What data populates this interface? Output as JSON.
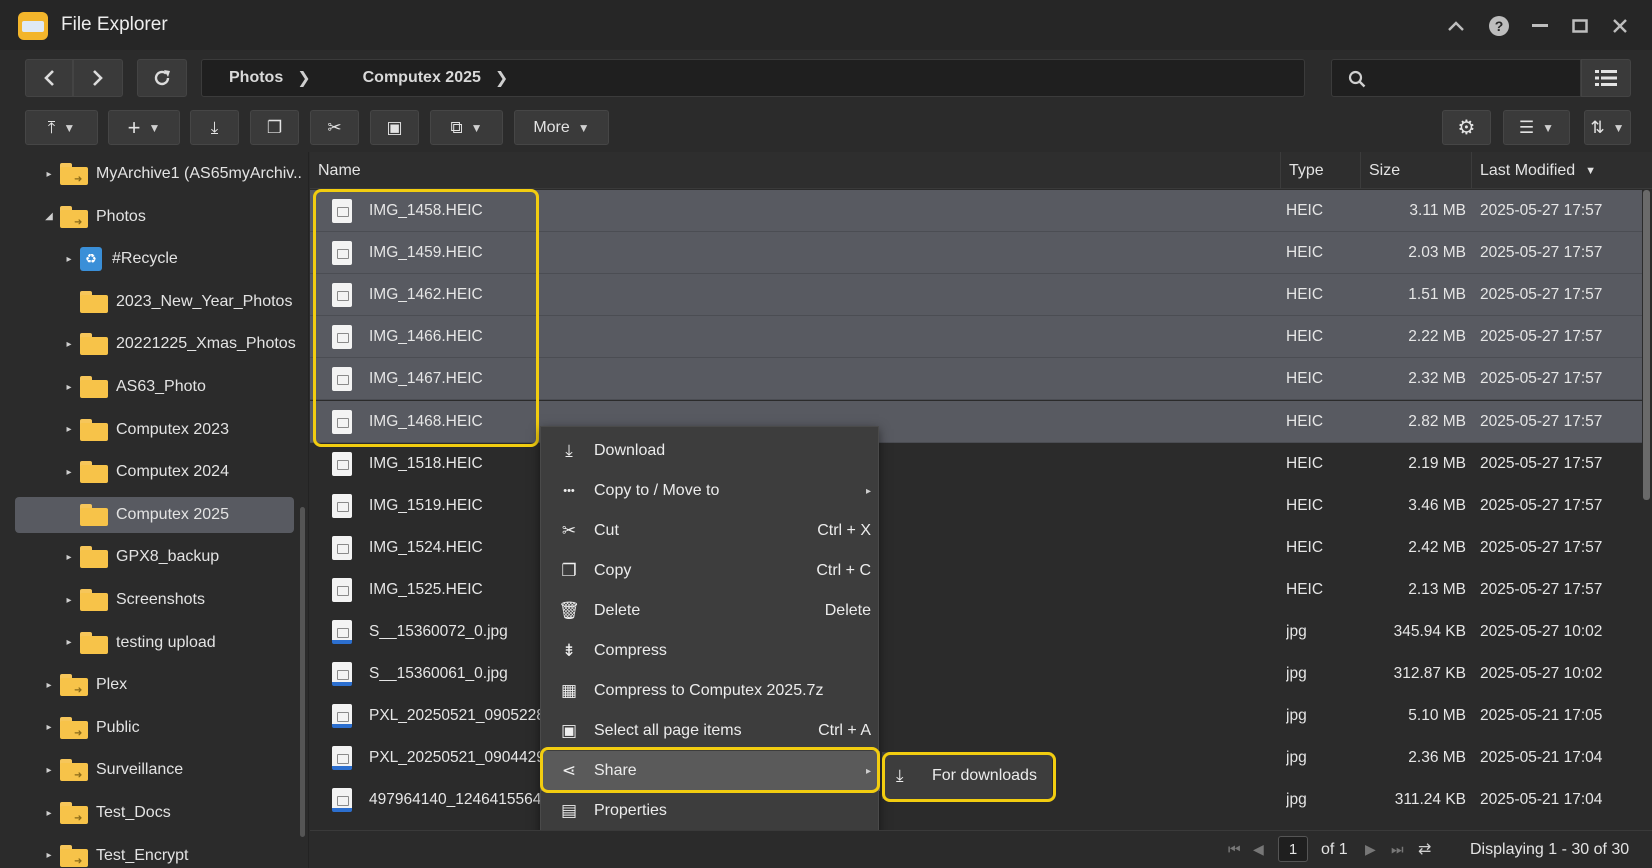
{
  "window": {
    "title": "File Explorer"
  },
  "breadcrumb": [
    {
      "label": "Photos"
    },
    {
      "label": "Computex 2025"
    }
  ],
  "search": {
    "placeholder": ""
  },
  "toolbar": {
    "more_label": "More"
  },
  "sidebar": {
    "items": [
      {
        "label": "MyArchive1 (AS65myArchiv..",
        "arrow": "▸",
        "kind": "share"
      },
      {
        "label": "Photos",
        "arrow": "◢",
        "kind": "share"
      },
      {
        "label": "#Recycle",
        "arrow": "▸",
        "kind": "recycle"
      },
      {
        "label": "2023_New_Year_Photos",
        "arrow": "",
        "kind": "folder"
      },
      {
        "label": "20221225_Xmas_Photos",
        "arrow": "▸",
        "kind": "folder"
      },
      {
        "label": "AS63_Photo",
        "arrow": "▸",
        "kind": "folder"
      },
      {
        "label": "Computex 2023",
        "arrow": "▸",
        "kind": "folder"
      },
      {
        "label": "Computex 2024",
        "arrow": "▸",
        "kind": "folder"
      },
      {
        "label": "Computex 2025",
        "arrow": "",
        "kind": "folder",
        "selected": true
      },
      {
        "label": "GPX8_backup",
        "arrow": "▸",
        "kind": "folder"
      },
      {
        "label": "Screenshots",
        "arrow": "▸",
        "kind": "folder"
      },
      {
        "label": "testing upload",
        "arrow": "▸",
        "kind": "folder"
      },
      {
        "label": "Plex",
        "arrow": "▸",
        "kind": "share"
      },
      {
        "label": "Public",
        "arrow": "▸",
        "kind": "share"
      },
      {
        "label": "Surveillance",
        "arrow": "▸",
        "kind": "share"
      },
      {
        "label": "Test_Docs",
        "arrow": "▸",
        "kind": "share"
      },
      {
        "label": "Test_Encrypt",
        "arrow": "▸",
        "kind": "share"
      }
    ]
  },
  "table": {
    "columns": {
      "name": "Name",
      "type": "Type",
      "size": "Size",
      "modified": "Last Modified"
    },
    "rows": [
      {
        "name": "IMG_1458.HEIC",
        "type": "HEIC",
        "size": "3.11 MB",
        "modified": "2025-05-27 17:57",
        "selected": true
      },
      {
        "name": "IMG_1459.HEIC",
        "type": "HEIC",
        "size": "2.03 MB",
        "modified": "2025-05-27 17:57",
        "selected": true
      },
      {
        "name": "IMG_1462.HEIC",
        "type": "HEIC",
        "size": "1.51 MB",
        "modified": "2025-05-27 17:57",
        "selected": true
      },
      {
        "name": "IMG_1466.HEIC",
        "type": "HEIC",
        "size": "2.22 MB",
        "modified": "2025-05-27 17:57",
        "selected": true
      },
      {
        "name": "IMG_1467.HEIC",
        "type": "HEIC",
        "size": "2.32 MB",
        "modified": "2025-05-27 17:57",
        "selected": true
      },
      {
        "name": "IMG_1468.HEIC",
        "type": "HEIC",
        "size": "2.82 MB",
        "modified": "2025-05-27 17:57",
        "selected": true
      },
      {
        "name": "IMG_1518.HEIC",
        "type": "HEIC",
        "size": "2.19 MB",
        "modified": "2025-05-27 17:57"
      },
      {
        "name": "IMG_1519.HEIC",
        "type": "HEIC",
        "size": "3.46 MB",
        "modified": "2025-05-27 17:57"
      },
      {
        "name": "IMG_1524.HEIC",
        "type": "HEIC",
        "size": "2.42 MB",
        "modified": "2025-05-27 17:57"
      },
      {
        "name": "IMG_1525.HEIC",
        "type": "HEIC",
        "size": "2.13 MB",
        "modified": "2025-05-27 17:57"
      },
      {
        "name": "S__15360072_0.jpg",
        "type": "jpg",
        "size": "345.94 KB",
        "modified": "2025-05-27 10:02"
      },
      {
        "name": "S__15360061_0.jpg",
        "type": "jpg",
        "size": "312.87 KB",
        "modified": "2025-05-27 10:02"
      },
      {
        "name": "PXL_20250521_0905228",
        "type": "jpg",
        "size": "5.10 MB",
        "modified": "2025-05-21 17:05"
      },
      {
        "name": "PXL_20250521_0904429",
        "type": "jpg",
        "size": "2.36 MB",
        "modified": "2025-05-21 17:04"
      },
      {
        "name": "497964140_1246415564",
        "type": "jpg",
        "size": "311.24 KB",
        "modified": "2025-05-21 17:04"
      }
    ]
  },
  "context_menu": {
    "items": [
      {
        "label": "Download",
        "shortcut": "",
        "icon": "download-icon",
        "glyph": "⤓"
      },
      {
        "label": "Copy to / Move to",
        "shortcut": "",
        "icon": "more-dots-icon",
        "glyph": "•••",
        "submenu": true
      },
      {
        "label": "Cut",
        "shortcut": "Ctrl + X",
        "icon": "scissors-icon",
        "glyph": "✂"
      },
      {
        "label": "Copy",
        "shortcut": "Ctrl + C",
        "icon": "copy-icon",
        "glyph": "❐"
      },
      {
        "label": "Delete",
        "shortcut": "Delete",
        "icon": "trash-icon",
        "glyph": "🗑"
      },
      {
        "label": "Compress",
        "shortcut": "",
        "icon": "compress-icon",
        "glyph": "⇟"
      },
      {
        "label": "Compress to Computex 2025.7z",
        "shortcut": "",
        "icon": "archive-icon",
        "glyph": "▦"
      },
      {
        "label": "Select all page items",
        "shortcut": "Ctrl + A",
        "icon": "select-all-icon",
        "glyph": "▣"
      },
      {
        "label": "Share",
        "shortcut": "",
        "icon": "share-icon",
        "glyph": "⋖",
        "submenu": true,
        "active": true
      },
      {
        "label": "Properties",
        "shortcut": "",
        "icon": "properties-icon",
        "glyph": "▤"
      }
    ],
    "share_submenu": {
      "label": "For downloads",
      "icon": "download-icon"
    }
  },
  "pagination": {
    "current_page": "1",
    "of_label": "of 1",
    "display_text": "Displaying 1 - 30 of 30"
  },
  "colors": {
    "highlight": "#f2cd10",
    "selection": "#585a61",
    "folder": "#f7c349"
  }
}
